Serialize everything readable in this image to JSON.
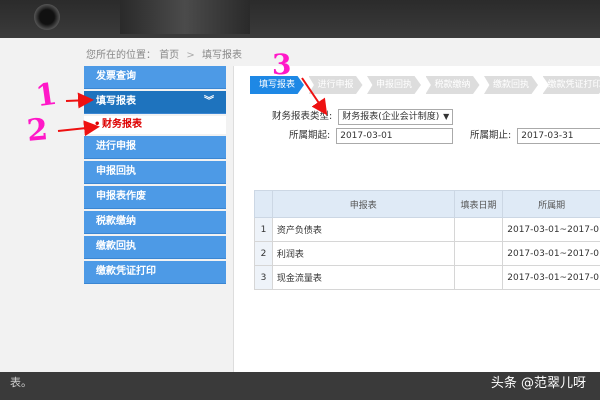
{
  "breadcrumb": {
    "prefix": "您所在的位置：",
    "home": "首页",
    "separator": ">",
    "current": "填写报表"
  },
  "sidebar": {
    "items": [
      {
        "label": "发票查询"
      },
      {
        "label": "填写报表",
        "chevron": "︾"
      },
      {
        "label": "进行申报"
      },
      {
        "label": "申报回执"
      },
      {
        "label": "申报表作废"
      },
      {
        "label": "税款缴纳"
      },
      {
        "label": "缴款回执"
      },
      {
        "label": "缴款凭证打印"
      }
    ],
    "sub_items": [
      {
        "label": "财务报表",
        "bullet": "•"
      }
    ]
  },
  "steps": [
    {
      "label": "填写报表"
    },
    {
      "label": "进行申报"
    },
    {
      "label": "申报回执"
    },
    {
      "label": "税款缴纳"
    },
    {
      "label": "缴款回执"
    },
    {
      "label": "缴款凭证打印"
    }
  ],
  "form": {
    "report_type_label": "财务报表类型:",
    "report_type_value": "财务报表(企业会计制度)",
    "period_start_label": "所属期起:",
    "period_start_value": "2017-03-01",
    "period_end_label": "所属期止:",
    "period_end_value": "2017-03-31"
  },
  "table": {
    "headers": [
      "申报表",
      "填表日期",
      "所属期"
    ],
    "rows": [
      {
        "no": "1",
        "name": "资产负债表",
        "date": "",
        "period": "2017-03-01~2017-0"
      },
      {
        "no": "2",
        "name": "利润表",
        "date": "",
        "period": "2017-03-01~2017-0"
      },
      {
        "no": "3",
        "name": "现金流量表",
        "date": "",
        "period": "2017-03-01~2017-0"
      }
    ]
  },
  "annotations": {
    "one": "1",
    "two": "2",
    "three": "3"
  },
  "bottom_text": "表。",
  "watermark": "头条 @范翠儿呀",
  "colors": {
    "nav_blue": "#4d9ae6",
    "nav_active": "#1e73be",
    "annotation": "#ff18c8",
    "sub_item_red": "#dd0000"
  }
}
